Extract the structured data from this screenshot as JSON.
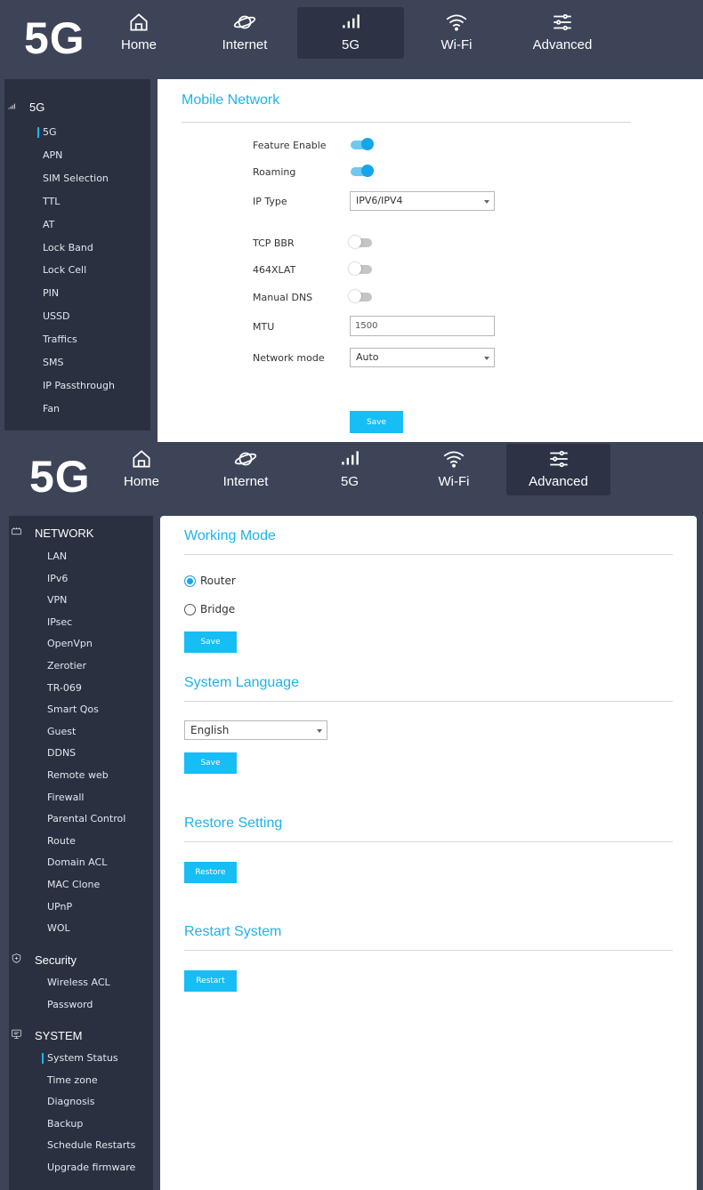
{
  "top": {
    "brand": "5G",
    "nav": [
      {
        "label": "Home",
        "icon": "home-icon"
      },
      {
        "label": "Internet",
        "icon": "planet-icon"
      },
      {
        "label": "5G",
        "icon": "signal-icon"
      },
      {
        "label": "Wi-Fi",
        "icon": "wifi-icon"
      },
      {
        "label": "Advanced",
        "icon": "sliders-icon"
      }
    ],
    "active_nav": "5G",
    "sidebar": {
      "heading": "5G",
      "items": [
        "5G",
        "APN",
        "SIM Selection",
        "TTL",
        "AT",
        "Lock Band",
        "Lock Cell",
        "PIN",
        "USSD",
        "Traffics",
        "SMS",
        "IP Passthrough",
        "Fan"
      ],
      "active": "5G"
    },
    "form": {
      "title": "Mobile Network",
      "feature_enable_label": "Feature Enable",
      "feature_enable": true,
      "roaming_label": "Roaming",
      "roaming": true,
      "ip_type_label": "IP Type",
      "ip_type": "IPV6/IPV4",
      "tcp_bbr_label": "TCP BBR",
      "tcp_bbr": false,
      "xlat_label": "464XLAT",
      "xlat": false,
      "manual_dns_label": "Manual DNS",
      "manual_dns": false,
      "mtu_label": "MTU",
      "mtu": "1500",
      "network_mode_label": "Network mode",
      "network_mode": "Auto",
      "save": "Save"
    }
  },
  "bottom": {
    "brand": "5G",
    "nav": [
      {
        "label": "Home",
        "icon": "home-icon"
      },
      {
        "label": "Internet",
        "icon": "planet-icon"
      },
      {
        "label": "5G",
        "icon": "signal-icon"
      },
      {
        "label": "Wi-Fi",
        "icon": "wifi-icon"
      },
      {
        "label": "Advanced",
        "icon": "sliders-icon"
      }
    ],
    "active_nav": "Advanced",
    "sidebar": {
      "network_heading": "NETWORK",
      "network_items": [
        "LAN",
        "IPv6",
        "VPN",
        "IPsec",
        "OpenVpn",
        "Zerotier",
        "TR-069",
        "Smart Qos",
        "Guest",
        "DDNS",
        "Remote web",
        "Firewall",
        "Parental Control",
        "Route",
        "Domain ACL",
        "MAC Clone",
        "UPnP",
        "WOL"
      ],
      "security_heading": "Security",
      "security_items": [
        "Wireless ACL",
        "Password"
      ],
      "system_heading": "SYSTEM",
      "system_items": [
        "System Status",
        "Time zone",
        "Diagnosis",
        "Backup",
        "Schedule Restarts",
        "Upgrade firmware"
      ],
      "active": "System Status"
    },
    "working_mode": {
      "title": "Working Mode",
      "options": [
        "Router",
        "Bridge"
      ],
      "selected": "Router",
      "save": "Save"
    },
    "language": {
      "title": "System Language",
      "value": "English",
      "save": "Save"
    },
    "restore": {
      "title": "Restore Setting",
      "button": "Restore"
    },
    "restart": {
      "title": "Restart System",
      "button": "Restart"
    }
  },
  "colors": {
    "accent": "#1fb3e8",
    "button": "#17bdf5",
    "header_bg": "#3d4458",
    "sidebar_bg": "#2a3040"
  }
}
